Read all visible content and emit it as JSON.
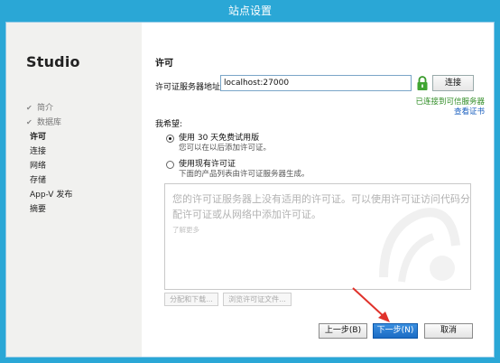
{
  "window": {
    "title": "站点设置"
  },
  "sidebar": {
    "app_name": "Studio",
    "items": [
      {
        "label": "简介",
        "state": "done"
      },
      {
        "label": "数据库",
        "state": "done"
      },
      {
        "label": "许可",
        "state": "current"
      },
      {
        "label": "连接",
        "state": "pending"
      },
      {
        "label": "网络",
        "state": "pending"
      },
      {
        "label": "存储",
        "state": "pending"
      },
      {
        "label": "App-V 发布",
        "state": "pending"
      },
      {
        "label": "摘要",
        "state": "pending"
      }
    ]
  },
  "license": {
    "title": "许可",
    "server_label": "许可证服务器地址:",
    "server_value": "localhost:27000",
    "connect_button": "连接",
    "status": "已连接到可信服务器",
    "view_cert": "查看证书",
    "want_label": "我希望:",
    "options": [
      {
        "label": "使用 30 天免费试用版",
        "sub": "您可以在以后添加许可证。",
        "selected": true
      },
      {
        "label": "使用现有许可证",
        "sub": "下面的产品列表由许可证服务器生成。",
        "selected": false
      }
    ],
    "info_message": "您的许可证服务器上没有适用的许可证。可以使用许可证访问代码分配许可证或从网络中添加许可证。",
    "learn_more": "了解更多",
    "allocate_button": "分配和下载...",
    "browse_button": "浏览许可证文件..."
  },
  "footer": {
    "back": "上一步(B)",
    "next": "下一步(N)",
    "cancel": "取消"
  },
  "colors": {
    "title_bar": "#2aa7d6",
    "primary_button": "#1c6cc4",
    "success_text": "#2d8b22",
    "link_text": "#1a5fbf",
    "annotation_arrow": "#e0322b"
  }
}
